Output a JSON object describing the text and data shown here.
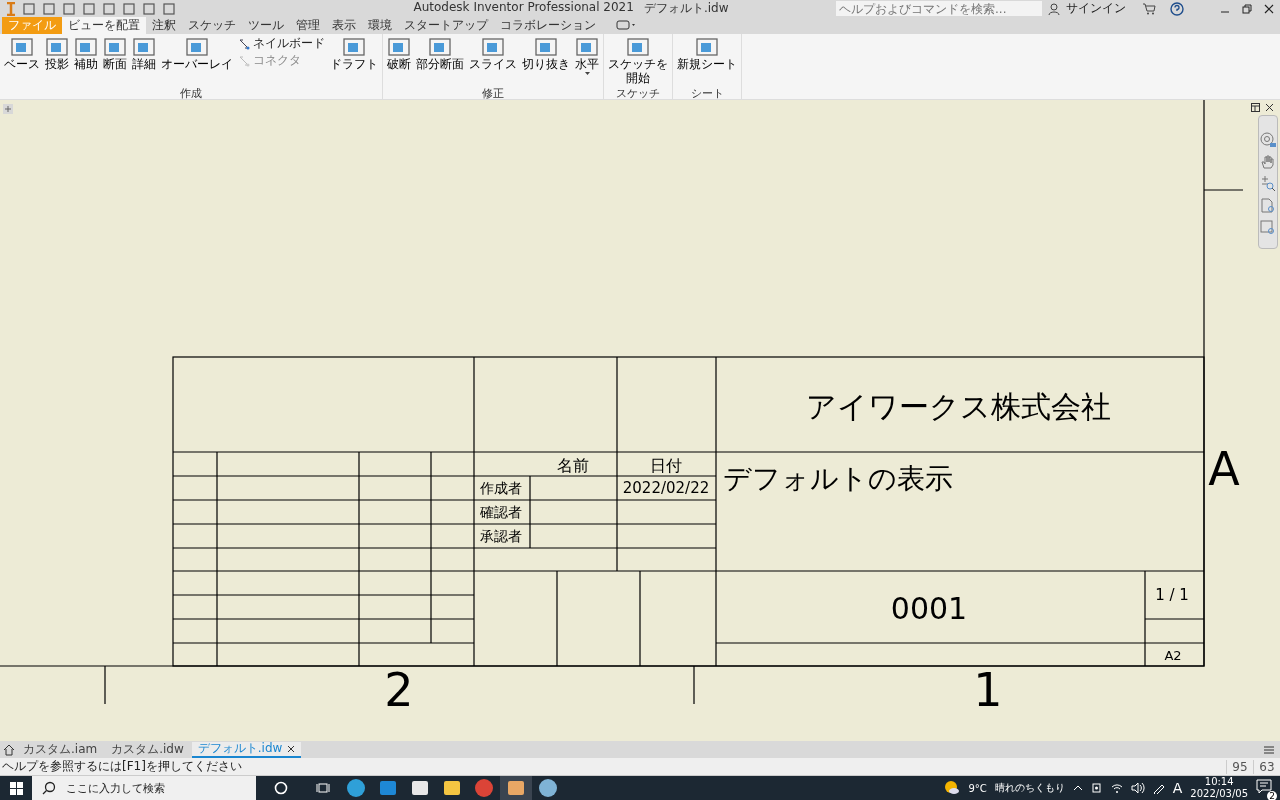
{
  "title_bar": {
    "app": "Autodesk Inventor Professional 2021",
    "document": "デフォルト.idw",
    "search": {
      "placeholder": "ヘルプおよびコマンドを検索..."
    },
    "sign_in": "サインイン"
  },
  "ribbon_tabs": [
    {
      "label": "ファイル",
      "kind": "file",
      "selected": false
    },
    {
      "label": "ビューを配置",
      "kind": "tab",
      "selected": true
    },
    {
      "label": "注釈",
      "kind": "tab",
      "selected": false
    },
    {
      "label": "スケッチ",
      "kind": "tab",
      "selected": false
    },
    {
      "label": "ツール",
      "kind": "tab",
      "selected": false
    },
    {
      "label": "管理",
      "kind": "tab",
      "selected": false
    },
    {
      "label": "表示",
      "kind": "tab",
      "selected": false
    },
    {
      "label": "環境",
      "kind": "tab",
      "selected": false
    },
    {
      "label": "スタートアップ",
      "kind": "tab",
      "selected": false
    },
    {
      "label": "コラボレーション",
      "kind": "tab",
      "selected": false
    }
  ],
  "ribbon_groups": [
    {
      "title": "作成",
      "buttons": [
        {
          "lines": [
            "ベース"
          ],
          "kind": "large"
        },
        {
          "lines": [
            "投影"
          ],
          "kind": "large"
        },
        {
          "lines": [
            "補助"
          ],
          "kind": "large"
        },
        {
          "lines": [
            "断面"
          ],
          "kind": "large"
        },
        {
          "lines": [
            "詳細"
          ],
          "kind": "large"
        },
        {
          "lines": [
            "オーバーレイ"
          ],
          "kind": "large"
        },
        {
          "lines": [
            "ネイルボード"
          ],
          "kind": "small",
          "disabled": false
        },
        {
          "lines": [
            "コネクタ"
          ],
          "kind": "small",
          "disabled": true
        },
        {
          "lines": [
            "ドラフト"
          ],
          "kind": "large"
        }
      ]
    },
    {
      "title": "修正",
      "buttons": [
        {
          "lines": [
            "破断"
          ],
          "kind": "large"
        },
        {
          "lines": [
            "部分断面"
          ],
          "kind": "large"
        },
        {
          "lines": [
            "スライス"
          ],
          "kind": "large"
        },
        {
          "lines": [
            "切り抜き"
          ],
          "kind": "large"
        },
        {
          "lines": [
            "水平"
          ],
          "kind": "dropdown"
        }
      ]
    },
    {
      "title": "スケッチ",
      "buttons": [
        {
          "lines": [
            "スケッチを",
            "開始"
          ],
          "kind": "large"
        }
      ]
    },
    {
      "title": "シート",
      "buttons": [
        {
          "lines": [
            "新規シート"
          ],
          "kind": "large"
        }
      ]
    }
  ],
  "title_block": {
    "company": "アイワークス株式会社",
    "drawing_title": "デフォルトの表示",
    "zone_letter": "A",
    "name_header": "名前",
    "date_header": "日付",
    "drawn_by": "作成者",
    "drawn_date": "2022/02/22",
    "checked_by": "確認者",
    "approved_by": "承認者",
    "drawing_number": "0001",
    "sheet": "1 / 1",
    "size": "A2",
    "zones": [
      "2",
      "1"
    ]
  },
  "document_tabs": [
    {
      "label": "カスタム.iam",
      "selected": false
    },
    {
      "label": "カスタム.idw",
      "selected": false
    },
    {
      "label": "デフォルト.idw",
      "selected": true
    }
  ],
  "status_bar": {
    "hint": "ヘルプを参照するには[F1]を押してください",
    "values": [
      "95",
      "63"
    ]
  },
  "taskbar": {
    "search": {
      "placeholder": "ここに入力して検索"
    },
    "temperature": "9°C",
    "weather": "晴れのちくもり",
    "ime": "A",
    "time": "10:14",
    "date": "2022/03/05",
    "notifications": "2"
  }
}
